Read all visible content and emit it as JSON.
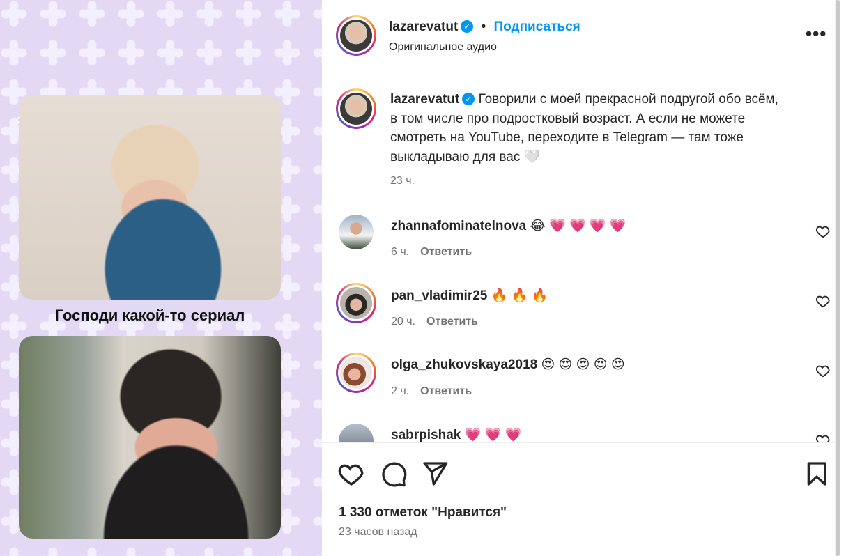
{
  "media": {
    "caption": "Господи какой-то сериал"
  },
  "post": {
    "author": "lazarevatut",
    "separator": "•",
    "follow_label": "Подписаться",
    "audio_label": "Оригинальное аудио",
    "more_label": "•••",
    "caption_text": "Говорили с моей прекрасной подругой обо всём, в том числе про подростковый возраст. А если не можете смотреть на YouTube, переходите в Telegram — там тоже выкладываю для вас 🤍",
    "caption_time": "23 ч."
  },
  "comments": [
    {
      "username": "zhannafominatelnova",
      "text": "😂 💗 💗 💗 💗",
      "time": "6 ч.",
      "reply_label": "Ответить"
    },
    {
      "username": "pan_vladimir25",
      "text": "🔥 🔥 🔥",
      "time": "20 ч.",
      "reply_label": "Ответить"
    },
    {
      "username": "olga_zhukovskaya2018",
      "text": "😍 😍 😍 😍 😍",
      "time": "2 ч.",
      "reply_label": "Ответить"
    },
    {
      "username": "sabrpishak",
      "text": "💗 💗 💗",
      "time": "",
      "reply_label": ""
    }
  ],
  "footer": {
    "likes_text": "1 330 отметок \"Нравится\"",
    "posted_text": "23 часов назад"
  },
  "colors": {
    "accent": "#0095f6",
    "muted": "#737373",
    "text": "#262626"
  }
}
